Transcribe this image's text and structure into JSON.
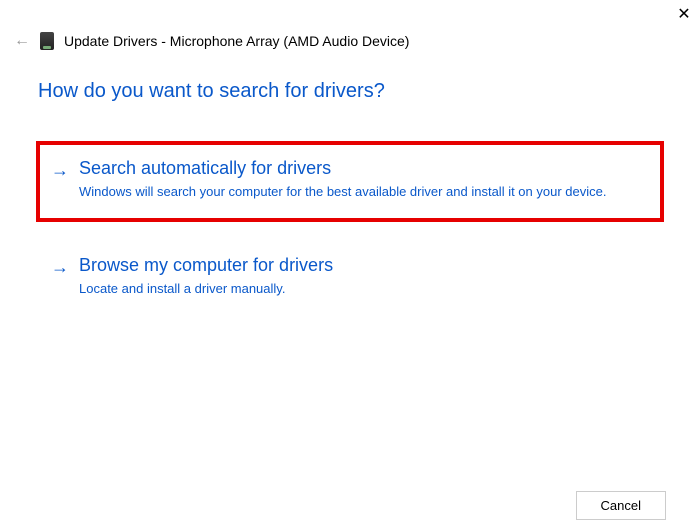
{
  "close_icon": "✕",
  "back_icon": "←",
  "window_title": "Update Drivers - Microphone Array (AMD Audio Device)",
  "heading": "How do you want to search for drivers?",
  "options": [
    {
      "arrow": "→",
      "title": "Search automatically for drivers",
      "desc": "Windows will search your computer for the best available driver and install it on your device."
    },
    {
      "arrow": "→",
      "title": "Browse my computer for drivers",
      "desc": "Locate and install a driver manually."
    }
  ],
  "cancel_label": "Cancel"
}
